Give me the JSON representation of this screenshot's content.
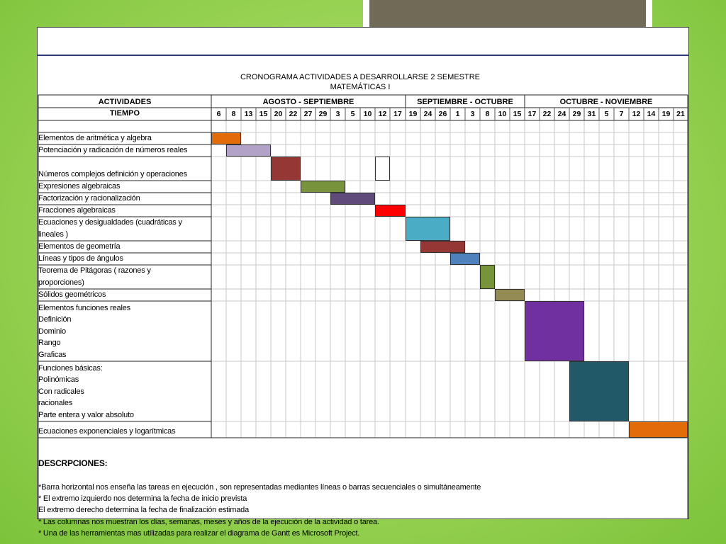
{
  "title_line1": "CRONOGRAMA ACTIVIDADES A DESARROLLARSE 2 SEMESTRE",
  "title_line2": "MATEMÁTICAS I",
  "headers": {
    "actividades": "ACTIVIDADES",
    "tiempo": "TIEMPO",
    "period1": "AGOSTO - SEPTIEMBRE",
    "period2": "SEPTIEMBRE - OCTUBRE",
    "period3": "OCTUBRE - NOVIEMBRE"
  },
  "ticks": [
    "6",
    "8",
    "13",
    "15",
    "20",
    "22",
    "27",
    "29",
    "3",
    "5",
    "10",
    "12",
    "17",
    "19",
    "24",
    "26",
    "1",
    "3",
    "8",
    "10",
    "15",
    "17",
    "22",
    "24",
    "29",
    "31",
    "5",
    "7",
    "12",
    "14",
    "19",
    "21"
  ],
  "activities": [
    {
      "label": "Elementos de aritmética y algebra",
      "start": 0,
      "end": 2,
      "color": "#e36c0a"
    },
    {
      "label": "Potenciación y radicación de números reales",
      "start": 1,
      "end": 4,
      "color": "#b3a2c7"
    },
    {
      "label": "Números complejos definición  y operaciones",
      "start": 4,
      "end": 6,
      "color": "#953735"
    },
    {
      "label": "Expresiones algebraicas",
      "start": 6,
      "end": 9,
      "color": "#77933c"
    },
    {
      "label": "Factorización  y racionalización",
      "start": 8,
      "end": 11,
      "color": "#604a7b"
    },
    {
      "label": "Fracciones algebraicas",
      "start": 11,
      "end": 13,
      "color": "#ff0000"
    },
    {
      "label": "Ecuaciones y desigualdades (cuadráticas y\nlineales )",
      "start": 13,
      "end": 16,
      "color": "#4bacc6"
    },
    {
      "label": "Elementos de geometría",
      "start": 14,
      "end": 17,
      "color": "#953735"
    },
    {
      "label": "Líneas y tipos de ángulos",
      "start": 16,
      "end": 18,
      "color": "#4f81bd"
    },
    {
      "label": "Teorema de Pitágoras  ( razones y\nproporciones)",
      "start": 18,
      "end": 19,
      "color": "#77933c"
    },
    {
      "label": "Sólidos geométricos",
      "start": 19,
      "end": 21,
      "color": "#948a54"
    },
    {
      "label": "Elementos funciones reales\nDefinición\nDominio\nRango\nGraficas",
      "start": 21,
      "end": 25,
      "color": "#7030a0"
    },
    {
      "label": "Funciones básicas:\nPolinómicas\nCon radicales\nracionales\nParte entera y valor absoluto",
      "start": 24,
      "end": 28,
      "color": "#215968"
    },
    {
      "label": "Ecuaciones exponenciales y logarítmicas",
      "start": 28,
      "end": 32,
      "color": "#e36c0a"
    }
  ],
  "description_title": "DESCRPCIONES:",
  "description_lines": "*Barra horizontal nos enseña las tareas en ejecución , son representadas mediantes líneas o barras secuenciales  o simultáneamente\n* El extremo izquierdo nos  determina la fecha  de inicio prevista\nEl extremo derecho determina la fecha de finalización  estimada\n* Las columnas nos muestran los días, semanas, meses y  años de la ejecución de la actividad o tarea.\n* Una de las herramientas mas utilizadas para  realizar el diagrama de Gantt  es Microsoft Project."
}
